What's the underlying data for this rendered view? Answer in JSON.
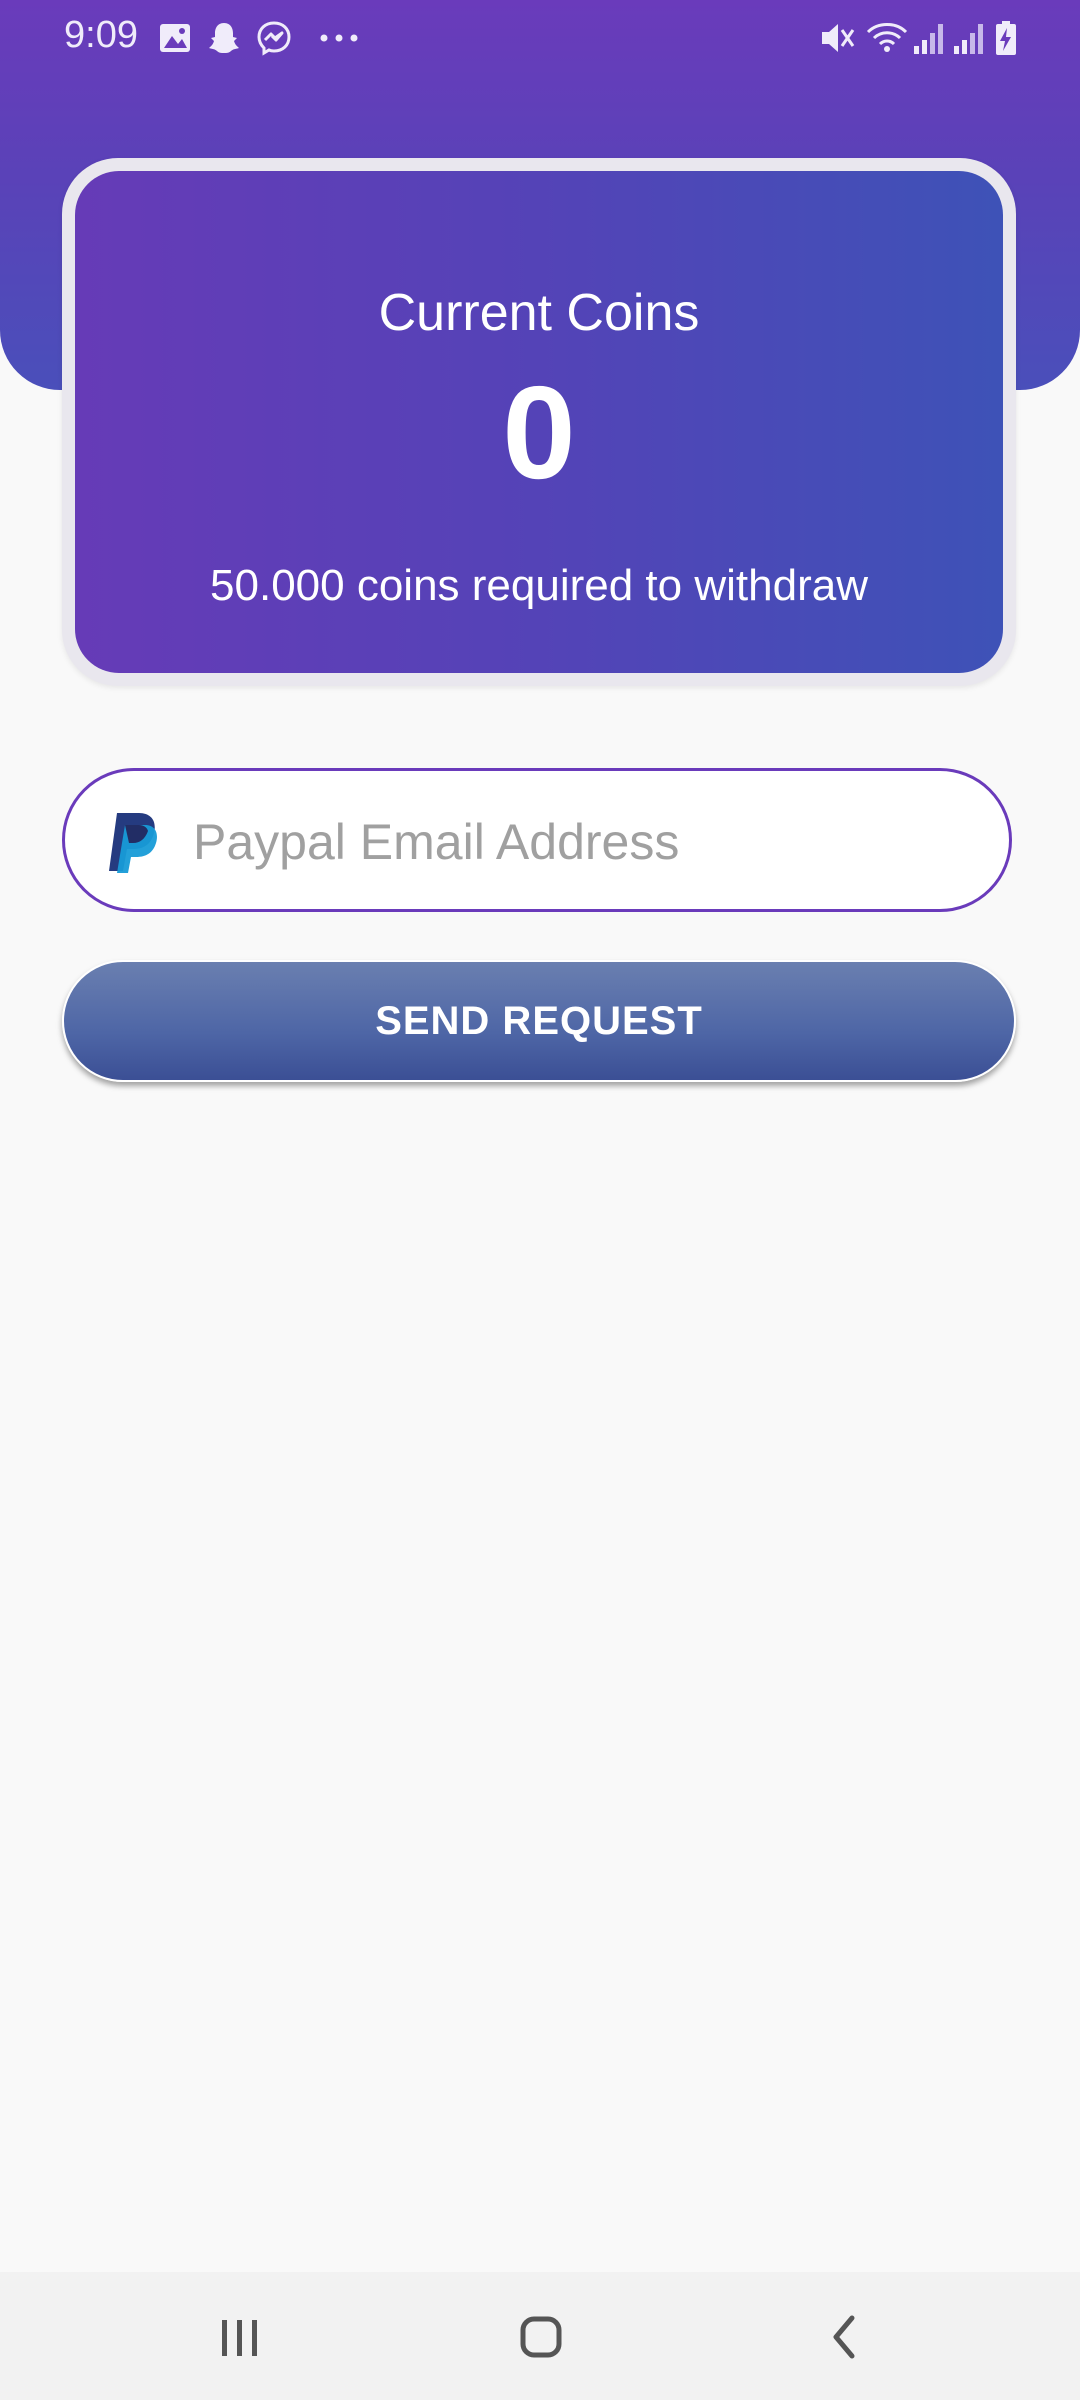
{
  "status_bar": {
    "time": "9:09",
    "left_icons": [
      "gallery-icon",
      "snapchat-icon",
      "messenger-icon",
      "more-dots-icon"
    ],
    "right_icons": [
      "mute-icon",
      "wifi-icon",
      "signal-icon",
      "signal-icon",
      "battery-charging-icon"
    ]
  },
  "coins_card": {
    "title": "Current Coins",
    "value": "0",
    "requirement": "50.000 coins required to withdraw"
  },
  "email_field": {
    "placeholder": "Paypal Email Address",
    "value": "",
    "icon": "paypal-icon"
  },
  "send_button": {
    "label": "SEND REQUEST"
  },
  "nav_bar": {
    "items": [
      "recent-apps-icon",
      "home-icon",
      "back-icon"
    ]
  },
  "colors": {
    "primary_purple": "#6a3bbb",
    "card_gradient_end": "#3e52b7",
    "button_blue": "#4e66a6",
    "background": "#f9f9f9"
  }
}
